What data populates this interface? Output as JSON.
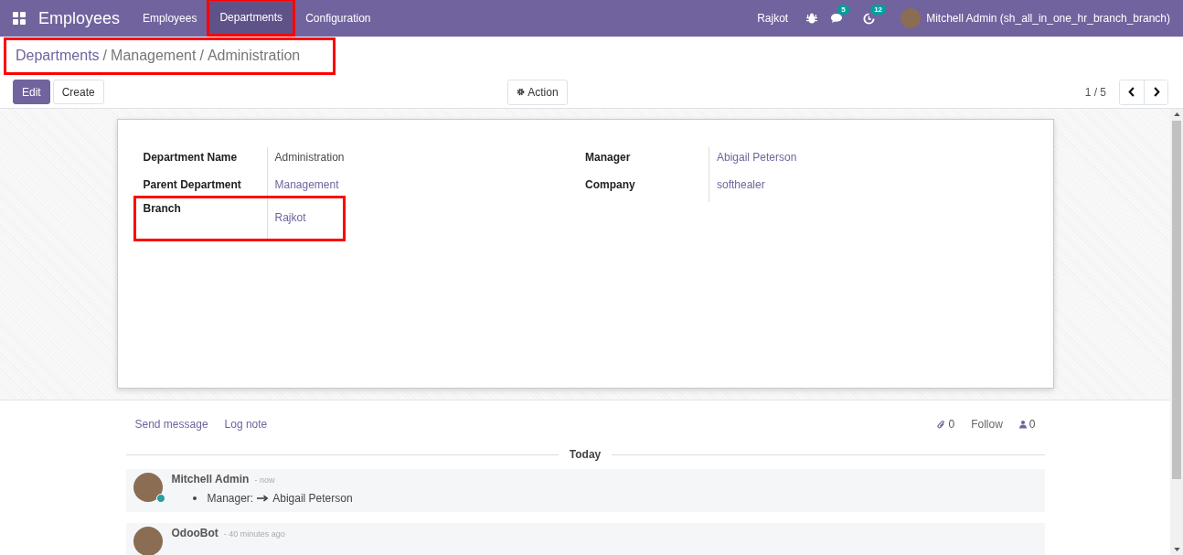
{
  "navbar": {
    "app_name": "Employees",
    "menu": [
      {
        "label": "Employees",
        "selected": false,
        "highlighted": false
      },
      {
        "label": "Departments",
        "selected": true,
        "highlighted": true
      },
      {
        "label": "Configuration",
        "selected": false,
        "highlighted": false
      }
    ],
    "branch": "Rajkot",
    "messages_badge": "5",
    "activities_badge": "12",
    "user": "Mitchell Admin (sh_all_in_one_hr_branch_branch)"
  },
  "breadcrumb": {
    "highlighted": true,
    "separator": "/",
    "items": [
      "Departments",
      "Management",
      "Administration"
    ]
  },
  "buttons": [
    {
      "label": "Edit",
      "kind": "primary"
    },
    {
      "label": "Create",
      "kind": "secondary"
    }
  ],
  "action_button": "Action",
  "pager": "1 / 5",
  "form": {
    "groups": [
      {
        "fields": [
          {
            "label": "Department Name",
            "value": "Administration",
            "kind": "text",
            "highlighted": false
          },
          {
            "label": "Parent Department",
            "value": "Management",
            "kind": "link",
            "highlighted": false
          },
          {
            "label": "Branch",
            "value": "Rajkot",
            "kind": "link",
            "highlighted": true
          }
        ]
      },
      {
        "fields": [
          {
            "label": "Manager",
            "value": "Abigail Peterson",
            "kind": "link",
            "highlighted": false
          },
          {
            "label": "Company",
            "value": "softhealer",
            "kind": "link",
            "highlighted": false
          }
        ]
      }
    ]
  },
  "chatter": {
    "send_message": "Send message",
    "log_note": "Log note",
    "attachments": "0",
    "follow": "Follow",
    "followers": "0",
    "separator": "Today",
    "messages": [
      {
        "author": "Mitchell Admin",
        "time": "- now",
        "online": true,
        "tracking": [
          {
            "field": "Manager:",
            "new_value": "Abigail Peterson"
          }
        ]
      },
      {
        "author": "OdooBot",
        "time": "- 40 minutes ago",
        "online": false
      }
    ]
  }
}
